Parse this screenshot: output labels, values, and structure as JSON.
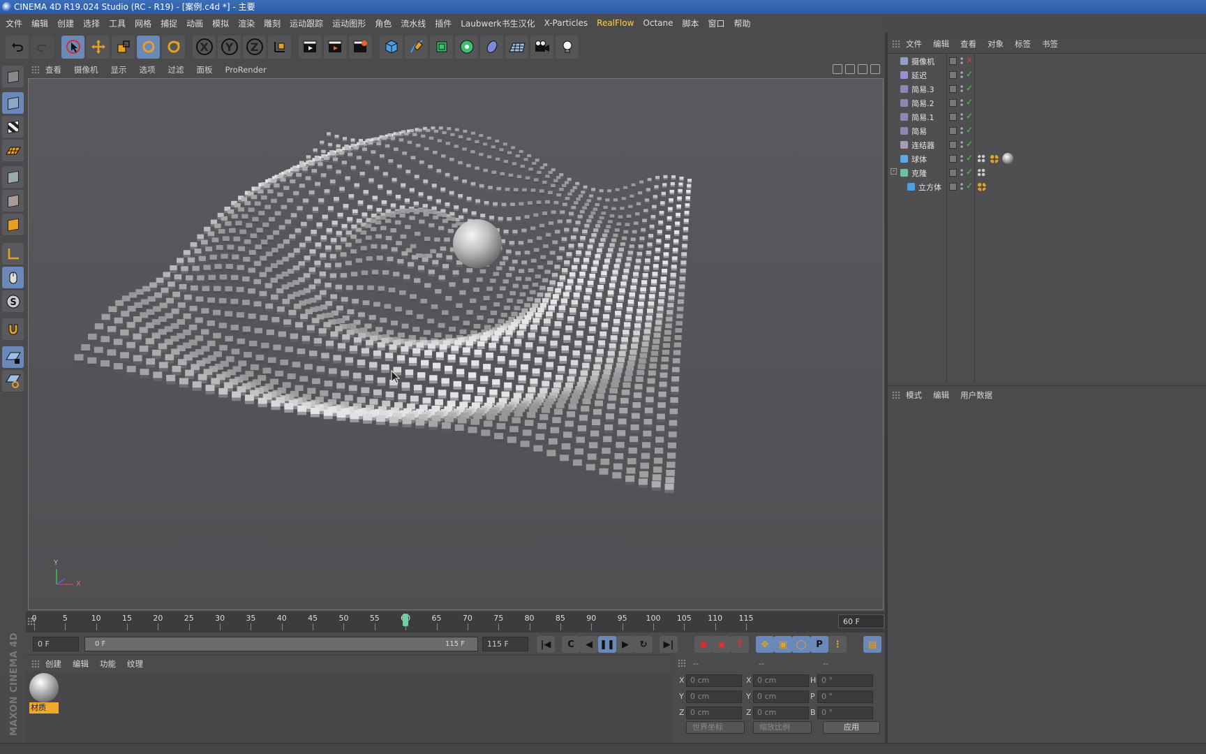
{
  "window": {
    "title": "CINEMA 4D R19.024 Studio (RC - R19) - [案例.c4d *] - 主要"
  },
  "menu": [
    "文件",
    "编辑",
    "创建",
    "选择",
    "工具",
    "网格",
    "捕捉",
    "动画",
    "模拟",
    "渲染",
    "雕刻",
    "运动跟踪",
    "运动图形",
    "角色",
    "流水线",
    "插件",
    "Laubwerk书生汉化",
    "X-Particles",
    "RealFlow",
    "Octane",
    "脚本",
    "窗口",
    "帮助"
  ],
  "toolbar": {
    "axis_x": "X",
    "axis_y": "Y",
    "axis_z": "Z"
  },
  "viewport": {
    "menu": [
      "查看",
      "摄像机",
      "显示",
      "选项",
      "过滤",
      "面板",
      "ProRender"
    ],
    "axis_x": "X",
    "axis_y": "Y"
  },
  "timeline": {
    "ticks": [
      0,
      5,
      10,
      15,
      20,
      25,
      30,
      35,
      40,
      45,
      50,
      55,
      60,
      65,
      70,
      75,
      80,
      85,
      90,
      95,
      100,
      105,
      110,
      115
    ],
    "current_frame": 60,
    "end_frame_label": "60 F",
    "start_field": "0 F",
    "range_lo": "0 F",
    "range_hi": "115 F",
    "end_field": "115 F"
  },
  "material_manager": {
    "menu": [
      "创建",
      "编辑",
      "功能",
      "纹理"
    ],
    "material_name": "材质"
  },
  "coordinates": {
    "heads": [
      "--",
      "--",
      "--"
    ],
    "rows": [
      {
        "a1": "X",
        "v1": "0 cm",
        "a2": "X",
        "v2": "0 cm",
        "a3": "H",
        "v3": "0 °"
      },
      {
        "a1": "Y",
        "v1": "0 cm",
        "a2": "Y",
        "v2": "0 cm",
        "a3": "P",
        "v3": "0 °"
      },
      {
        "a1": "Z",
        "v1": "0 cm",
        "a2": "Z",
        "v2": "0 cm",
        "a3": "B",
        "v3": "0 °"
      }
    ],
    "world_dropdown": "世界坐标",
    "scale_dropdown": "缩放比例",
    "apply": "应用"
  },
  "object_manager": {
    "menu": [
      "文件",
      "编辑",
      "查看",
      "对象",
      "标签",
      "书签"
    ],
    "objects": [
      {
        "name": "摄像机",
        "icon": "camera-icon",
        "color": "#8fa0c0",
        "indent": 0
      },
      {
        "name": "延迟",
        "icon": "delay-effector-icon",
        "color": "#9c8fd0",
        "indent": 0
      },
      {
        "name": "简易.3",
        "icon": "plain-effector-icon",
        "color": "#8a8ab0",
        "indent": 0
      },
      {
        "name": "简易.2",
        "icon": "plain-effector-icon",
        "color": "#8a8ab0",
        "indent": 0
      },
      {
        "name": "简易.1",
        "icon": "plain-effector-icon",
        "color": "#8a8ab0",
        "indent": 0
      },
      {
        "name": "简易",
        "icon": "plain-effector-icon",
        "color": "#8a8ab0",
        "indent": 0
      },
      {
        "name": "连结器",
        "icon": "connector-icon",
        "color": "#a0a0b0",
        "indent": 0
      },
      {
        "name": "球体",
        "icon": "sphere-icon",
        "color": "#5aa8e6",
        "indent": 0
      },
      {
        "name": "克隆",
        "icon": "cloner-icon",
        "color": "#6ac0a0",
        "indent": 0
      },
      {
        "name": "立方体",
        "icon": "cube-icon",
        "color": "#4aa0e0",
        "indent": 1
      }
    ]
  },
  "attribute_manager": {
    "menu": [
      "模式",
      "编辑",
      "用户数据"
    ]
  },
  "branding": {
    "logo": "MAXON CINEMA 4D"
  }
}
